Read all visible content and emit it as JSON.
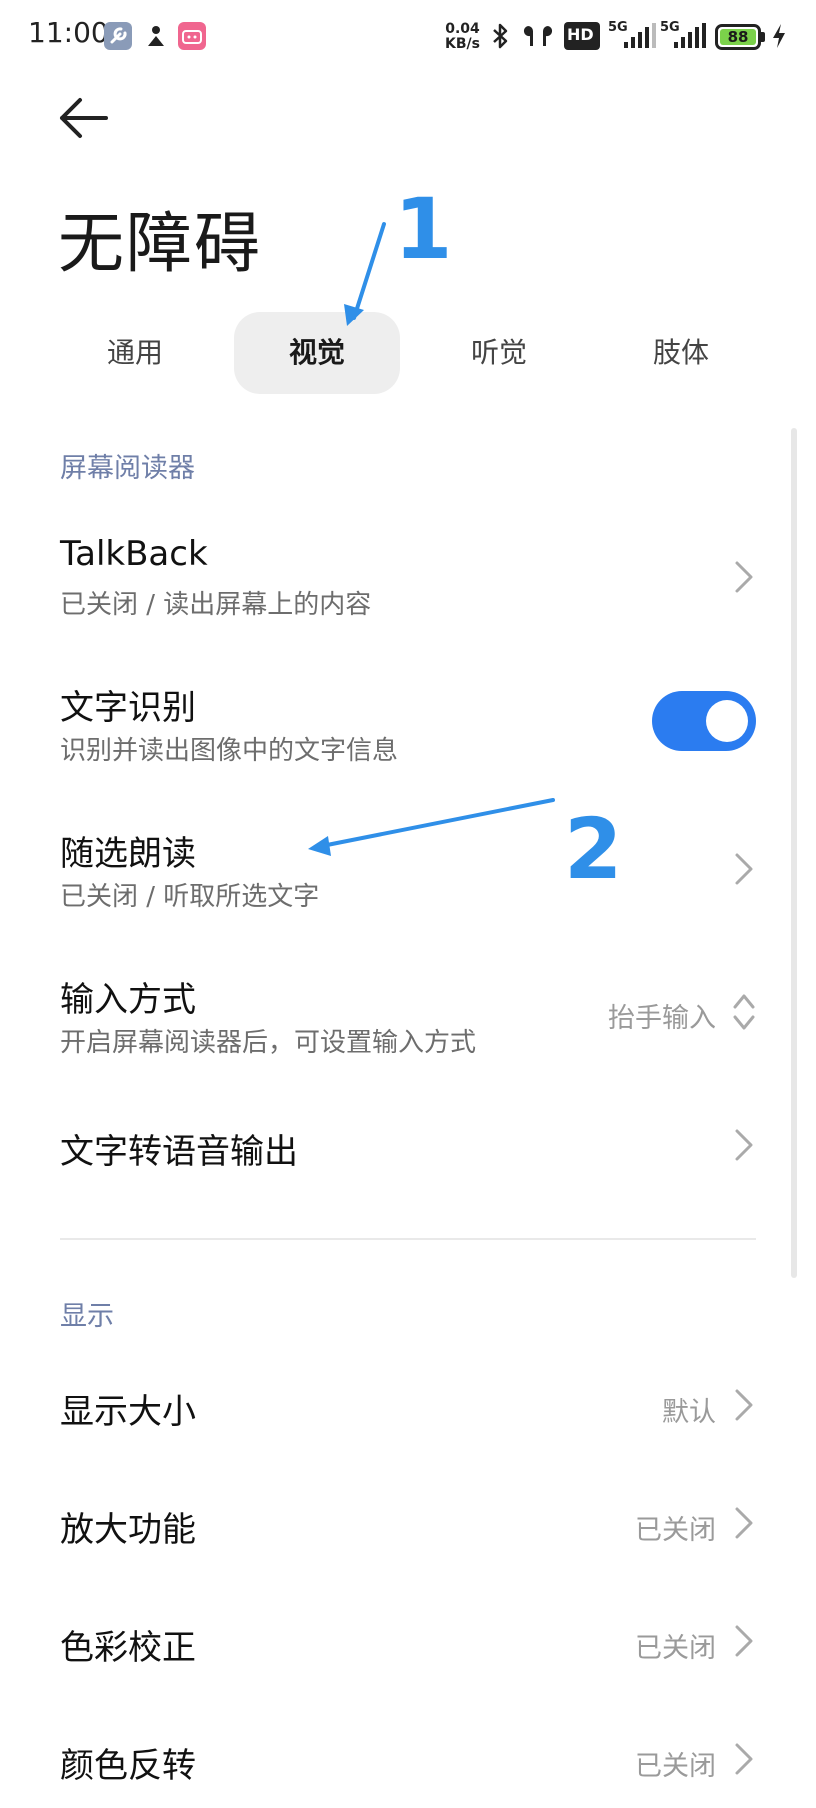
{
  "status_bar": {
    "time": "11:00",
    "net_speed_value": "0.04",
    "net_speed_unit": "KB/s",
    "hd_label": "HD",
    "sim1_label": "5G",
    "sim2_label": "5G",
    "battery_level": "88",
    "icons": [
      "wrench-icon",
      "person-download-icon",
      "bilibili-icon",
      "bluetooth-icon",
      "earbuds-icon",
      "hd-voice-icon",
      "signal-icon",
      "battery-icon",
      "charging-icon"
    ]
  },
  "header": {
    "back_icon": "back-arrow-icon",
    "title": "无障碍"
  },
  "tabs": [
    {
      "label": "通用",
      "active": false
    },
    {
      "label": "视觉",
      "active": true
    },
    {
      "label": "听觉",
      "active": false
    },
    {
      "label": "肢体",
      "active": false
    }
  ],
  "sections": {
    "screen_reader": {
      "header": "屏幕阅读器",
      "items": {
        "talkback": {
          "title": "TalkBack",
          "subtitle": "已关闭 / 读出屏幕上的内容"
        },
        "text_recognition": {
          "title": "文字识别",
          "subtitle": "识别并读出图像中的文字信息",
          "toggle_on": true
        },
        "select_to_speak": {
          "title": "随选朗读",
          "subtitle": "已关闭 / 听取所选文字"
        },
        "input_method": {
          "title": "输入方式",
          "subtitle": "开启屏幕阅读器后，可设置输入方式",
          "value": "抬手输入"
        },
        "tts_output": {
          "title": "文字转语音输出"
        }
      }
    },
    "display": {
      "header": "显示",
      "items": {
        "display_size": {
          "title": "显示大小",
          "value": "默认"
        },
        "magnification": {
          "title": "放大功能",
          "value": "已关闭"
        },
        "color_correction": {
          "title": "色彩校正",
          "value": "已关闭"
        },
        "color_inversion": {
          "title": "颜色反转",
          "value": "已关闭"
        }
      }
    }
  },
  "annotations": {
    "label_1": "1",
    "label_2": "2",
    "color": "#2f8fe8"
  },
  "colors": {
    "accent": "#2b7cf0",
    "section_header": "#6f7fa8",
    "active_tab_bg": "#eeeeee"
  }
}
